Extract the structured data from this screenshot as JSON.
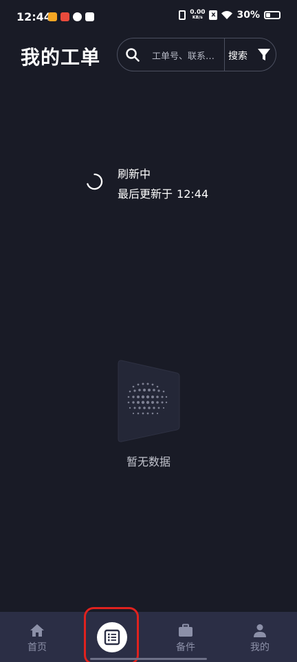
{
  "status_bar": {
    "time": "12:44",
    "net_speed_value": "0.00",
    "net_speed_unit": "KB/s",
    "sim_label": "x",
    "battery": "30%"
  },
  "header": {
    "title": "我的工单",
    "search_placeholder": "工单号、联系…",
    "search_button": "搜索"
  },
  "refresh": {
    "status": "刷新中",
    "last_updated_label": "最后更新于",
    "last_updated_time": "12:44"
  },
  "empty_state": {
    "text": "暂无数据"
  },
  "bottom_nav": {
    "items": [
      {
        "label": "首页",
        "icon": "home-icon"
      },
      {
        "label": "",
        "icon": "list-icon",
        "active": true
      },
      {
        "label": "备件",
        "icon": "briefcase-icon"
      },
      {
        "label": "我的",
        "icon": "user-icon"
      }
    ]
  },
  "colors": {
    "background": "#191b26",
    "nav_background": "#2b2e45",
    "highlight": "#e0221e"
  }
}
